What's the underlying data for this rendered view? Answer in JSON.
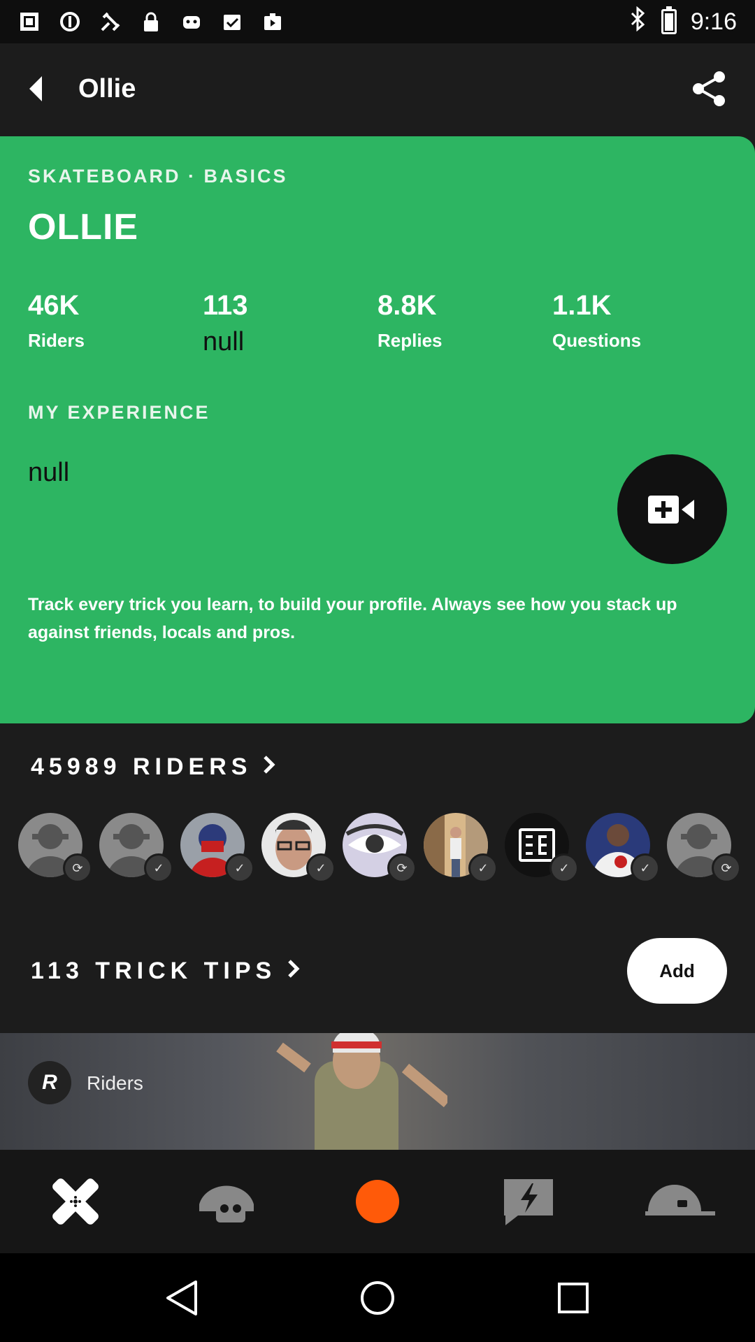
{
  "status_bar": {
    "time": "9:16",
    "icons": [
      "image-icon",
      "sync-icon",
      "satellite-icon",
      "lock-icon",
      "robot-icon",
      "inbox-icon",
      "play-store-icon",
      "bluetooth-icon",
      "battery-icon"
    ]
  },
  "app_bar": {
    "title": "Ollie"
  },
  "card": {
    "category": "SKATEBOARD · BASICS",
    "trick_title": "OLLIE",
    "stats": [
      {
        "value": "46K",
        "label": "Riders"
      },
      {
        "value": "113",
        "label": "null"
      },
      {
        "value": "8.8K",
        "label": "Replies"
      },
      {
        "value": "1.1K",
        "label": "Questions"
      }
    ],
    "experience_label": "MY EXPERIENCE",
    "experience_value": "null",
    "description": "Track every trick you learn, to build your profile. Always see how you stack up against friends, locals and pros.",
    "accent_color": "#2db562"
  },
  "riders": {
    "header": "45989 RIDERS",
    "avatars": [
      {
        "type": "placeholder",
        "badge": "sync"
      },
      {
        "type": "placeholder",
        "badge": "check"
      },
      {
        "type": "masked-rider",
        "badge": "check"
      },
      {
        "type": "glasses-man",
        "badge": "check"
      },
      {
        "type": "eye-closeup",
        "badge": "sync"
      },
      {
        "type": "street-photo",
        "badge": "check"
      },
      {
        "type": "sb-logo",
        "badge": "check"
      },
      {
        "type": "suit-man",
        "badge": "check"
      },
      {
        "type": "placeholder",
        "badge": "sync"
      }
    ]
  },
  "trick_tips": {
    "header": "113 TRICK TIPS",
    "add_label": "Add"
  },
  "preview": {
    "logo_letter": "R",
    "label": "Riders"
  },
  "bottom_nav": {
    "items": [
      "tricks-icon",
      "skull-helmet-icon",
      "record-icon",
      "lightning-chat-icon",
      "cap-icon"
    ],
    "record_color": "#ff5a09"
  },
  "system_nav": {
    "items": [
      "back-icon",
      "home-icon",
      "recents-icon"
    ]
  }
}
